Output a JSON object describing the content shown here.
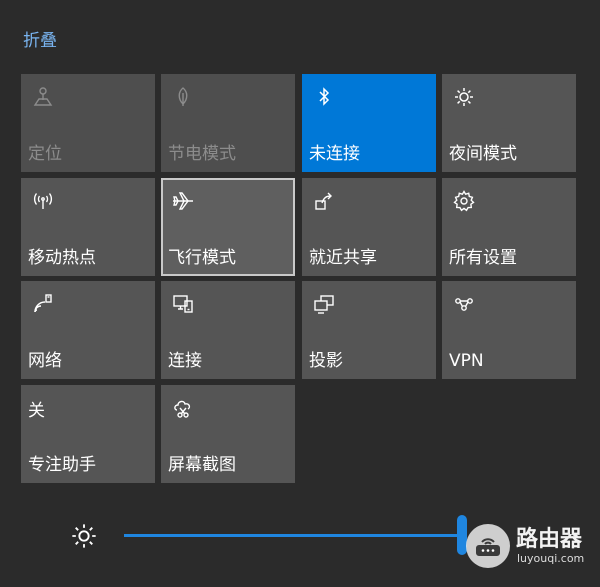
{
  "header": {
    "collapse_label": "折叠"
  },
  "tiles": [
    {
      "label": "定位",
      "icon": "location-icon",
      "state": "off"
    },
    {
      "label": "节电模式",
      "icon": "battery-saver-icon",
      "state": "off"
    },
    {
      "label": "未连接",
      "icon": "bluetooth-icon",
      "state": "active"
    },
    {
      "label": "夜间模式",
      "icon": "night-light-icon",
      "state": "normal"
    },
    {
      "label": "移动热点",
      "icon": "mobile-hotspot-icon",
      "state": "normal"
    },
    {
      "label": "飞行模式",
      "icon": "airplane-icon",
      "state": "focus"
    },
    {
      "label": "就近共享",
      "icon": "nearby-share-icon",
      "state": "normal"
    },
    {
      "label": "所有设置",
      "icon": "gear-icon",
      "state": "normal"
    },
    {
      "label": "网络",
      "icon": "network-icon",
      "state": "normal"
    },
    {
      "label": "连接",
      "icon": "connect-icon",
      "state": "normal"
    },
    {
      "label": "投影",
      "icon": "project-icon",
      "state": "normal"
    },
    {
      "label": "VPN",
      "icon": "vpn-icon",
      "state": "normal"
    },
    {
      "label": "关",
      "icon": "focus-assist-label",
      "state": "normal"
    },
    {
      "label": "专注助手",
      "icon": "focus-assist-icon",
      "state": "normal"
    },
    {
      "label": "屏幕截图",
      "icon": "screen-snip-icon",
      "state": "normal"
    }
  ],
  "brightness": {
    "icon": "brightness-icon",
    "level_percent": 98
  },
  "watermark": {
    "title": "路由器",
    "url": "luyouqi.com"
  },
  "colors": {
    "background": "#2b2b2b",
    "tile": "#555555",
    "accent": "#0078d7",
    "link": "#79b4f0",
    "disabled_text": "#8c8c8c"
  }
}
